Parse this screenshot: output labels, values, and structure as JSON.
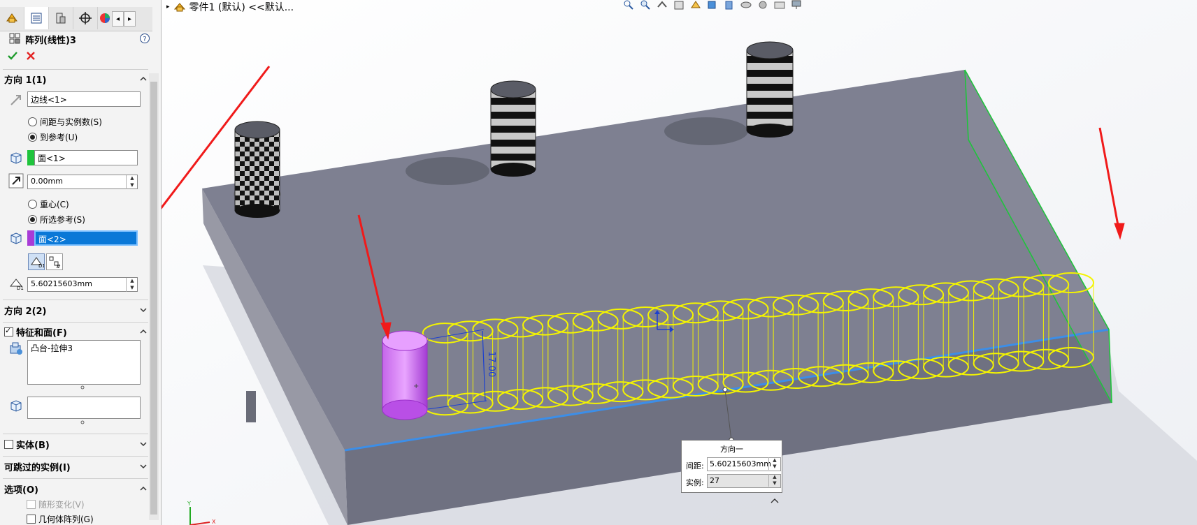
{
  "property_manager": {
    "title": "阵列(线性)3",
    "direction1": {
      "header": "方向 1(1)",
      "edge_value": "边线<1>",
      "radio_spacing": "间距与实例数(S)",
      "radio_to_ref": "到参考(U)",
      "face_value": "面<1>",
      "offset_value": "0.00mm",
      "radio_centroid": "重心(C)",
      "radio_selected_ref": "所选参考(S)",
      "selected_face_value": "面<2>",
      "spacing_value": "5.60215603mm"
    },
    "direction2": {
      "header": "方向 2(2)"
    },
    "features": {
      "header": "特征和面(F)",
      "list_item": "凸台-拉伸3",
      "faces_value": ""
    },
    "bodies": {
      "header": "实体(B)"
    },
    "skip": {
      "header": "可跳过的实例(I)"
    },
    "options": {
      "header": "选项(O)",
      "vary_sketch": "随形变化(V)",
      "geometry_pattern": "几何体阵列(G)"
    }
  },
  "breadcrumb": {
    "text": "零件1 (默认) <<默认..."
  },
  "callout": {
    "title": "方向一",
    "spacing_label": "间距:",
    "spacing_value": "5.60215603mm",
    "instances_label": "实例:",
    "instances_value": "27"
  },
  "dimension_label": "17.00",
  "colors": {
    "accent_blue": "#3c8ee8",
    "select_purple": "#a83bd6",
    "select_green": "#1fc43c",
    "preview_yellow": "#f4f400",
    "arrow_red": "#f01a1a",
    "block_top": "#7e8091",
    "block_front": "#6f7181",
    "block_left": "#9899a5"
  }
}
